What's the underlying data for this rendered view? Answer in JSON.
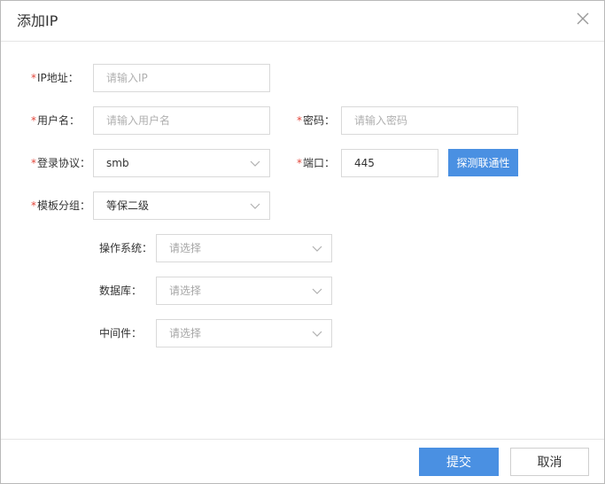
{
  "dialog": {
    "title": "添加IP",
    "close_icon": "close-icon"
  },
  "form": {
    "required_mark": "*",
    "ip": {
      "label": "IP地址：",
      "placeholder": "请输入IP",
      "value": ""
    },
    "username": {
      "label": "用户名：",
      "placeholder": "请输入用户名",
      "value": ""
    },
    "password": {
      "label": "密码：",
      "placeholder": "请输入密码",
      "value": ""
    },
    "protocol": {
      "label": "登录协议：",
      "value": "smb"
    },
    "port": {
      "label": "端口：",
      "value": "445"
    },
    "test_button": "探测联通性",
    "template_group": {
      "label": "模板分组：",
      "value": "等保二级"
    },
    "os": {
      "label": "操作系统：",
      "placeholder": "请选择"
    },
    "database": {
      "label": "数据库：",
      "placeholder": "请选择"
    },
    "middleware": {
      "label": "中间件：",
      "placeholder": "请选择"
    }
  },
  "footer": {
    "submit_label": "提交",
    "cancel_label": "取消"
  },
  "colors": {
    "primary": "#4a90e2",
    "required": "#e2463b",
    "border": "#d9d9d9"
  },
  "icons": {
    "dropdown": "chevron-down-icon"
  }
}
